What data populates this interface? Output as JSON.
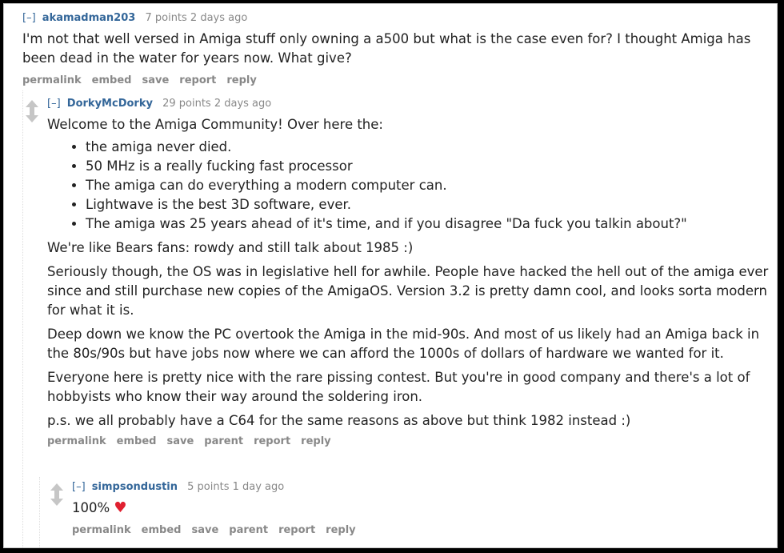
{
  "comments": [
    {
      "toggle": "[–]",
      "author": "akamadman203",
      "meta": "7 points 2 days ago",
      "paragraphs": [
        "I'm not that well versed in Amiga stuff only owning a a500 but what is the case even for? I thought Amiga has been dead in the water for years now. What give?"
      ],
      "actions": [
        "permalink",
        "embed",
        "save",
        "report",
        "reply"
      ]
    },
    {
      "toggle": "[–]",
      "author": "DorkyMcDorky",
      "meta": "29 points 2 days ago",
      "intro": "Welcome to the Amiga Community! Over here the:",
      "bullets": [
        "the amiga never died.",
        "50 MHz is a really fucking fast processor",
        "The amiga can do everything a modern computer can.",
        "Lightwave is the best 3D software, ever.",
        "The amiga was 25 years ahead of it's time, and if you disagree \"Da fuck you talkin about?\""
      ],
      "paragraphs": [
        "We're like Bears fans: rowdy and still talk about 1985 :)",
        "Seriously though, the OS was in legislative hell for awhile. People have hacked the hell out of the amiga ever since and still purchase new copies of the AmigaOS. Version 3.2 is pretty damn cool, and looks sorta modern for what it is.",
        "Deep down we know the PC overtook the Amiga in the mid-90s. And most of us likely had an Amiga back in the 80s/90s but have jobs now where we can afford the 1000s of dollars of hardware we wanted for it.",
        "Everyone here is pretty nice with the rare pissing contest. But you're in good company and there's a lot of hobbyists who know their way around the soldering iron.",
        "p.s. we all probably have a C64 for the same reasons as above but think 1982 instead :)"
      ],
      "actions": [
        "permalink",
        "embed",
        "save",
        "parent",
        "report",
        "reply"
      ]
    },
    {
      "toggle": "[–]",
      "author": "simpsondustin",
      "meta": "5 points 1 day ago",
      "text": "100%",
      "emoji": "♥",
      "actions": [
        "permalink",
        "embed",
        "save",
        "parent",
        "report",
        "reply"
      ]
    }
  ]
}
